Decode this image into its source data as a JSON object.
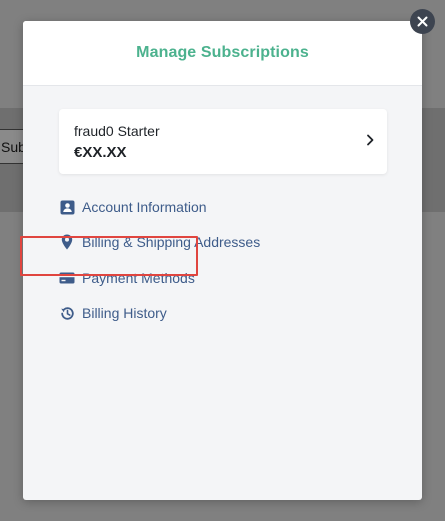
{
  "background": {
    "subscribe_fragment": "Sub"
  },
  "modal": {
    "title": "Manage Subscriptions",
    "close_icon": "close-icon"
  },
  "plan": {
    "name": "fraud0 Starter",
    "price": "€XX.XX",
    "chevron_icon": "chevron-right-icon"
  },
  "menu": {
    "items": [
      {
        "label": "Account Information",
        "icon": "contact-card-icon"
      },
      {
        "label": "Billing & Shipping Addresses",
        "icon": "location-pin-icon"
      },
      {
        "label": "Payment Methods",
        "icon": "credit-card-icon"
      },
      {
        "label": "Billing History",
        "icon": "history-icon"
      }
    ]
  },
  "colors": {
    "title_accent": "#4cb28e",
    "link": "#3e5c8a",
    "highlight": "#e0453f",
    "close_bg": "#3d4450"
  }
}
